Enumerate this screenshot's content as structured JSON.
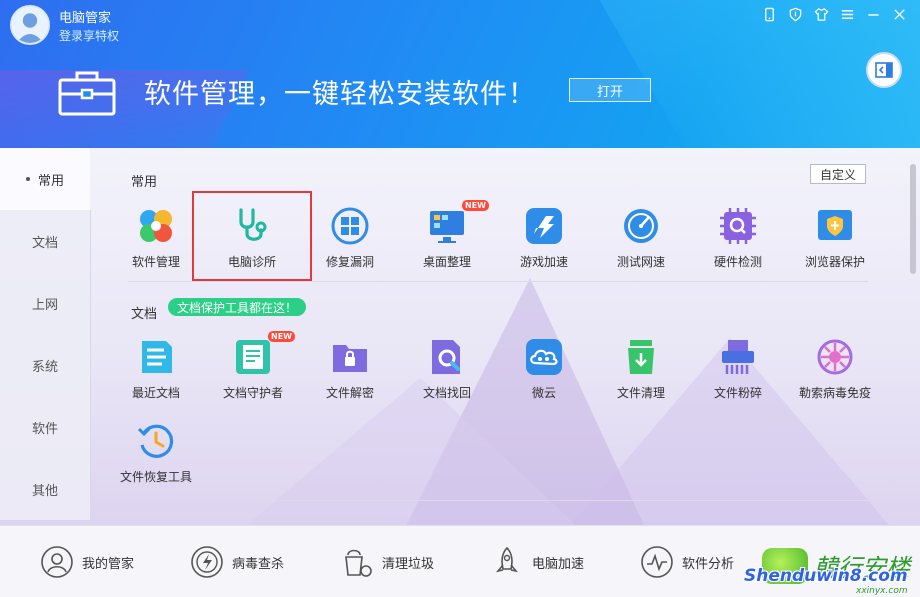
{
  "header": {
    "app_title": "电脑管家",
    "login_link": "登录享特权",
    "banner_text": "软件管理，一键轻松安装软件！",
    "open_label": "打开",
    "window_controls": [
      "phone-icon",
      "shield-icon",
      "skin-icon",
      "menu-icon",
      "minimize-icon",
      "close-icon"
    ]
  },
  "sidebar": {
    "items": [
      {
        "label": "常用",
        "active": true
      },
      {
        "label": "文档",
        "active": false
      },
      {
        "label": "上网",
        "active": false
      },
      {
        "label": "系统",
        "active": false
      },
      {
        "label": "软件",
        "active": false
      },
      {
        "label": "其他",
        "active": false
      }
    ]
  },
  "sections": {
    "common": {
      "title": "常用",
      "customize_label": "自定义",
      "tools": [
        {
          "label": "软件管理",
          "icon": "pinwheel-icon"
        },
        {
          "label": "电脑诊所",
          "icon": "stethoscope-icon",
          "selected": true
        },
        {
          "label": "修复漏洞",
          "icon": "windows-repair-icon"
        },
        {
          "label": "桌面整理",
          "icon": "monitor-icon",
          "badge": "NEW"
        },
        {
          "label": "游戏加速",
          "icon": "game-boost-icon"
        },
        {
          "label": "测试网速",
          "icon": "speedometer-icon"
        },
        {
          "label": "硬件检测",
          "icon": "chip-icon"
        },
        {
          "label": "浏览器保护",
          "icon": "browser-shield-icon"
        }
      ]
    },
    "docs": {
      "title": "文档",
      "tag": "文档保护工具都在这！",
      "tools": [
        {
          "label": "最近文档",
          "icon": "recent-docs-icon"
        },
        {
          "label": "文档守护者",
          "icon": "doc-guard-icon",
          "badge": "NEW"
        },
        {
          "label": "文件解密",
          "icon": "folder-lock-icon"
        },
        {
          "label": "文档找回",
          "icon": "doc-search-icon"
        },
        {
          "label": "微云",
          "icon": "weiyun-cloud-icon"
        },
        {
          "label": "文件清理",
          "icon": "trash-icon"
        },
        {
          "label": "文件粉碎",
          "icon": "shredder-icon"
        },
        {
          "label": "勒索病毒免疫",
          "icon": "virus-icon"
        },
        {
          "label": "文件恢复工具",
          "icon": "restore-clock-icon"
        }
      ]
    }
  },
  "bottom_nav": [
    {
      "label": "我的管家",
      "icon": "my-butler-icon"
    },
    {
      "label": "病毒查杀",
      "icon": "virus-scan-icon"
    },
    {
      "label": "清理垃圾",
      "icon": "cleanup-icon"
    },
    {
      "label": "电脑加速",
      "icon": "rocket-icon"
    },
    {
      "label": "软件分析",
      "icon": "software-analysis-icon"
    }
  ],
  "watermark": {
    "cn": "韓行安楼",
    "en": "Shenduwin8.com",
    "url": "xxinyx.com"
  },
  "colors": {
    "header_blue": "#1f8df4",
    "selected_border": "#e13a3a",
    "tag_green": "#2ccf86",
    "new_badge": "#ff4a3a"
  }
}
